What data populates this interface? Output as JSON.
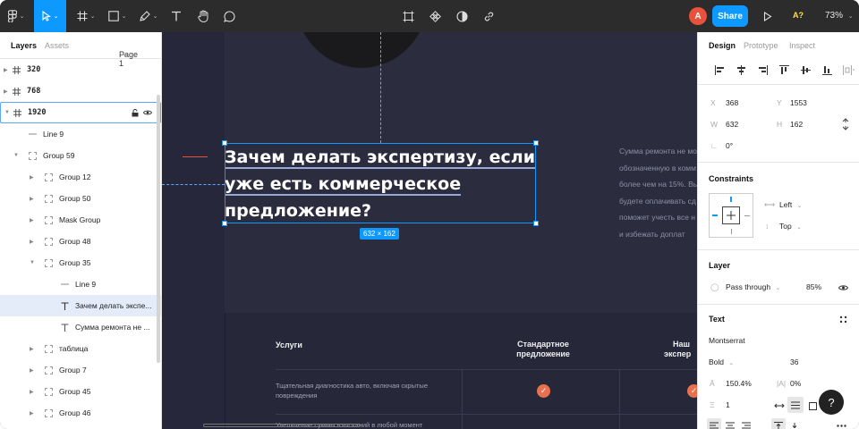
{
  "toolbar": {
    "avatar_initial": "A",
    "share_label": "Share",
    "aq_label": "A?",
    "zoom_level": "73%"
  },
  "left_panel": {
    "tabs": {
      "layers": "Layers",
      "assets": "Assets"
    },
    "page_selector": "Page 1",
    "layers": [
      {
        "label": "320"
      },
      {
        "label": "768"
      },
      {
        "label": "1920"
      },
      {
        "label": "Line 9"
      },
      {
        "label": "Group 59"
      },
      {
        "label": "Group 12"
      },
      {
        "label": "Group 50"
      },
      {
        "label": "Mask Group"
      },
      {
        "label": "Group 48"
      },
      {
        "label": "Group 35"
      },
      {
        "label": "Line 9"
      },
      {
        "label": "Зачем делать экспе..."
      },
      {
        "label": "Сумма ремонта не ..."
      },
      {
        "label": "таблица"
      },
      {
        "label": "Group 7"
      },
      {
        "label": "Group 45"
      },
      {
        "label": "Group 46"
      }
    ]
  },
  "canvas": {
    "heading_lines": [
      "Зачем делать экспертизу, если",
      "уже есть коммерческое",
      "предложение?"
    ],
    "selection_size": "632 × 162",
    "paragraph_lines": [
      "Сумма ремонта не мо",
      "обозначенную в комм",
      "более чем на 15%. Вы",
      "будете оплачивать сд",
      "поможет учесть все н",
      "и избежать доплат"
    ],
    "table": {
      "headers": [
        "Услуги",
        "Стандартное предложение",
        "Наш эксперт"
      ],
      "header_lines": [
        [
          "Услуги"
        ],
        [
          "Стандартное",
          "предложение"
        ],
        [
          "Наш",
          "экспер"
        ]
      ],
      "rows": [
        {
          "lines": [
            "Тщательная диагностика авто, включая скрытые",
            "повреждения"
          ]
        },
        {
          "lines": [
            "Увеличение суммы взысканий в любой момент"
          ]
        }
      ],
      "check_mark": "✓"
    }
  },
  "right_panel": {
    "tabs": {
      "design": "Design",
      "prototype": "Prototype",
      "inspect": "Inspect"
    },
    "x_label": "X",
    "x_value": "368",
    "y_label": "Y",
    "y_value": "1553",
    "w_label": "W",
    "w_value": "632",
    "h_label": "H",
    "h_value": "162",
    "rotation": "0°",
    "constraints_title": "Constraints",
    "constraint_h": "Left",
    "constraint_v": "Top",
    "layer_title": "Layer",
    "blend_mode": "Pass through",
    "opacity": "85%",
    "text_title": "Text",
    "font_family": "Montserrat",
    "font_weight": "Bold",
    "font_size": "36",
    "line_height": "150.4%",
    "letter_spacing": "0%",
    "paragraph_spacing": "1"
  },
  "help_label": "?"
}
